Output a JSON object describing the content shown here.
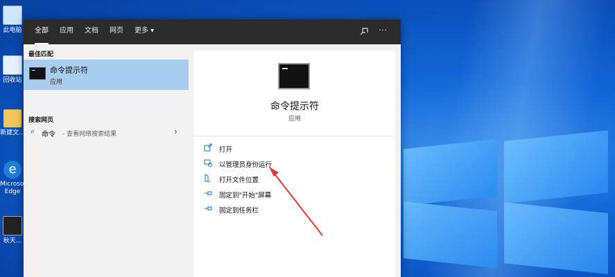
{
  "desktop": {
    "icons": [
      {
        "label": "此电脑"
      },
      {
        "label": "回收站"
      },
      {
        "label": "新建文..."
      },
      {
        "label": "Microsoft Edge"
      },
      {
        "label": "秋天..."
      }
    ]
  },
  "topbar": {
    "tabs": [
      {
        "label": "全部"
      },
      {
        "label": "应用"
      },
      {
        "label": "文档"
      },
      {
        "label": "网页"
      },
      {
        "label": "更多 ▾"
      }
    ],
    "feedback_icon": "feedback-icon",
    "more_icon": "⋯"
  },
  "left": {
    "best_match_header": "最佳匹配",
    "best_match": {
      "title": "命令提示符",
      "subtitle": "应用"
    },
    "web_header": "搜索网页",
    "web_item": {
      "query": "命令",
      "hint": " - 查看网络搜索结果"
    }
  },
  "right": {
    "title": "命令提示符",
    "subtitle": "应用",
    "actions": [
      {
        "label": "打开",
        "icon": "open-icon"
      },
      {
        "label": "以管理员身份运行",
        "icon": "run-as-admin-icon"
      },
      {
        "label": "打开文件位置",
        "icon": "file-location-icon"
      },
      {
        "label": "固定到\"开始\"屏幕",
        "icon": "pin-start-icon"
      },
      {
        "label": "固定到任务栏",
        "icon": "pin-taskbar-icon"
      }
    ]
  },
  "colors": {
    "highlight": "#a9cdee",
    "topbar": "#2b2b2b",
    "annotation_arrow": "#e03a2f"
  }
}
